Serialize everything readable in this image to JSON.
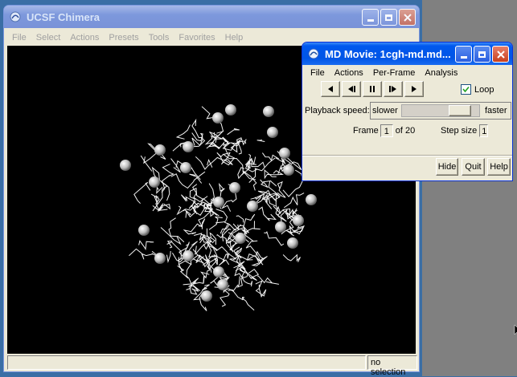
{
  "chimera": {
    "title": "UCSF Chimera",
    "menu": [
      "File",
      "Select",
      "Actions",
      "Presets",
      "Tools",
      "Favorites",
      "Help"
    ],
    "status_right": "no selection"
  },
  "md_movie": {
    "title": "MD Movie: 1cgh-md.md...",
    "menu": [
      "File",
      "Actions",
      "Per-Frame",
      "Analysis"
    ],
    "loop_label": "Loop",
    "loop_checked": true,
    "playback_label": "Playback speed:",
    "slower_label": "slower",
    "faster_label": "faster",
    "speed_fraction": 0.85,
    "frame_label": "Frame",
    "frame_value": "1",
    "frame_of": "of 20",
    "step_label": "Step size",
    "step_value": "1",
    "hide_label": "Hide",
    "quit_label": "Quit",
    "help_label": "Help"
  },
  "icons": [
    "chimera-icon",
    "minimize-icon",
    "maximize-icon",
    "close-icon",
    "play-backward-icon",
    "step-backward-icon",
    "pause-icon",
    "step-forward-icon",
    "play-forward-icon"
  ]
}
